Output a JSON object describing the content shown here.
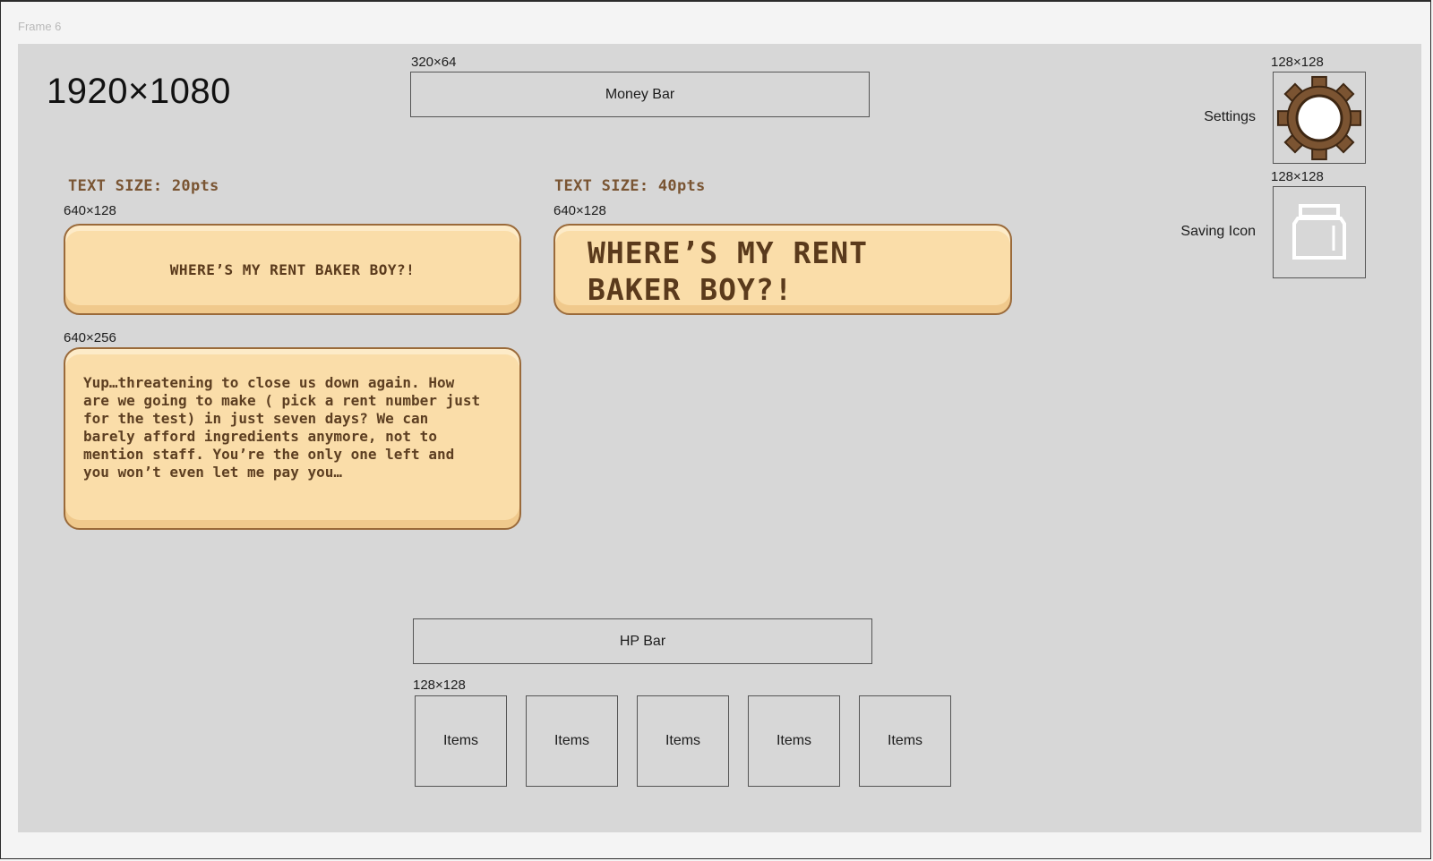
{
  "frame": {
    "label": "Frame 6"
  },
  "resolution": "1920×1080",
  "money_bar": {
    "dim": "320×64",
    "label": "Money Bar"
  },
  "settings": {
    "dim": "128×128",
    "label": "Settings",
    "icon": "gear-icon"
  },
  "saving": {
    "dim": "128×128",
    "label": "Saving Icon",
    "icon": "jar-icon"
  },
  "dialog_small": {
    "text_size": "TEXT SIZE: 20pts",
    "dim": "640×128",
    "text": "WHERE’S MY RENT BAKER BOY?!"
  },
  "dialog_large": {
    "text_size": "TEXT SIZE: 40pts",
    "dim": "640×128",
    "line1": "WHERE’S MY RENT",
    "line2": "BAKER BOY?!"
  },
  "dialog_body": {
    "dim": "640×256",
    "lines": [
      "Yup…threatening to close us down again. How",
      "are we going to make ( pick a rent number just",
      "for the test) in just seven days? We can",
      "barely afford ingredients anymore, not to",
      "mention staff. You’re the only one left and",
      "you won’t even let me pay you…"
    ]
  },
  "hp_bar": {
    "label": "HP Bar"
  },
  "items": {
    "dim": "128×128",
    "slots": [
      "Items",
      "Items",
      "Items",
      "Items",
      "Items"
    ]
  },
  "colors": {
    "canvas": "#d7d7d7",
    "bubble_fill": "#fadda9",
    "bubble_border": "#9a6a3a",
    "bubble_text": "#5a3a1c",
    "gear": "#7b5432"
  }
}
